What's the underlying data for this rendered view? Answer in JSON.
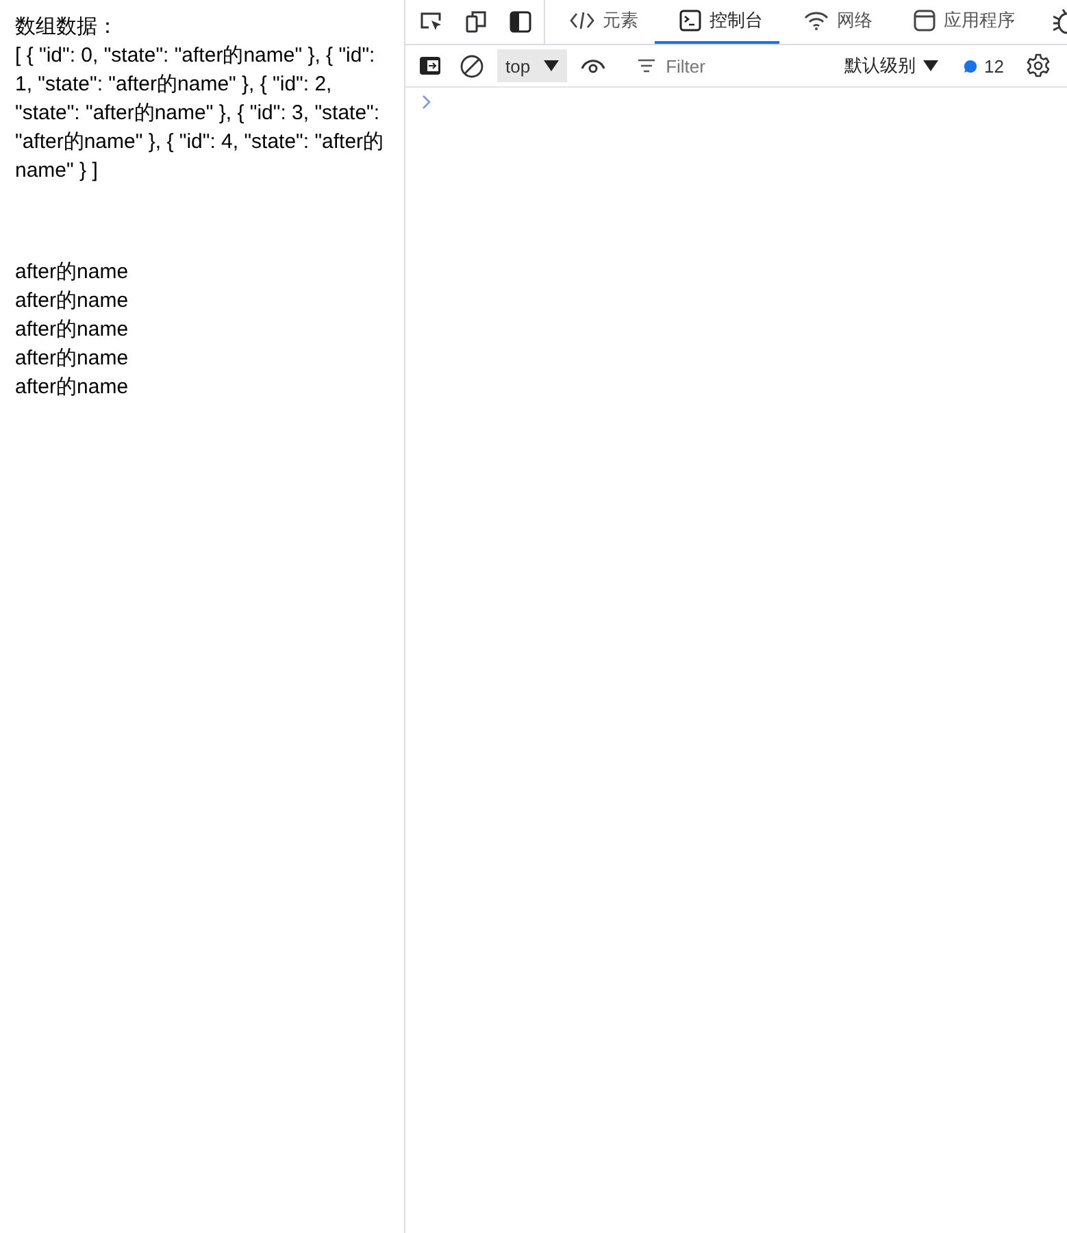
{
  "page": {
    "heading": "数组数据：",
    "array_text": "[ { \"id\": 0, \"state\": \"after的name\" }, { \"id\": 1, \"state\": \"after的name\" }, { \"id\": 2, \"state\": \"after的name\" }, { \"id\": 3, \"state\": \"after的name\" }, { \"id\": 4, \"state\": \"after的name\" } ]",
    "items": [
      "after的name",
      "after的name",
      "after的name",
      "after的name",
      "after的name"
    ]
  },
  "devtools": {
    "tabs": [
      {
        "label": "元素",
        "kind": "code",
        "selected": false
      },
      {
        "label": "控制台",
        "kind": "console",
        "selected": true
      },
      {
        "label": "网络",
        "kind": "network",
        "selected": false
      },
      {
        "label": "应用程序",
        "kind": "application",
        "selected": false
      }
    ],
    "context": "top",
    "filter": {
      "placeholder": "Filter"
    },
    "level": "默认级别",
    "message_count": "12"
  }
}
